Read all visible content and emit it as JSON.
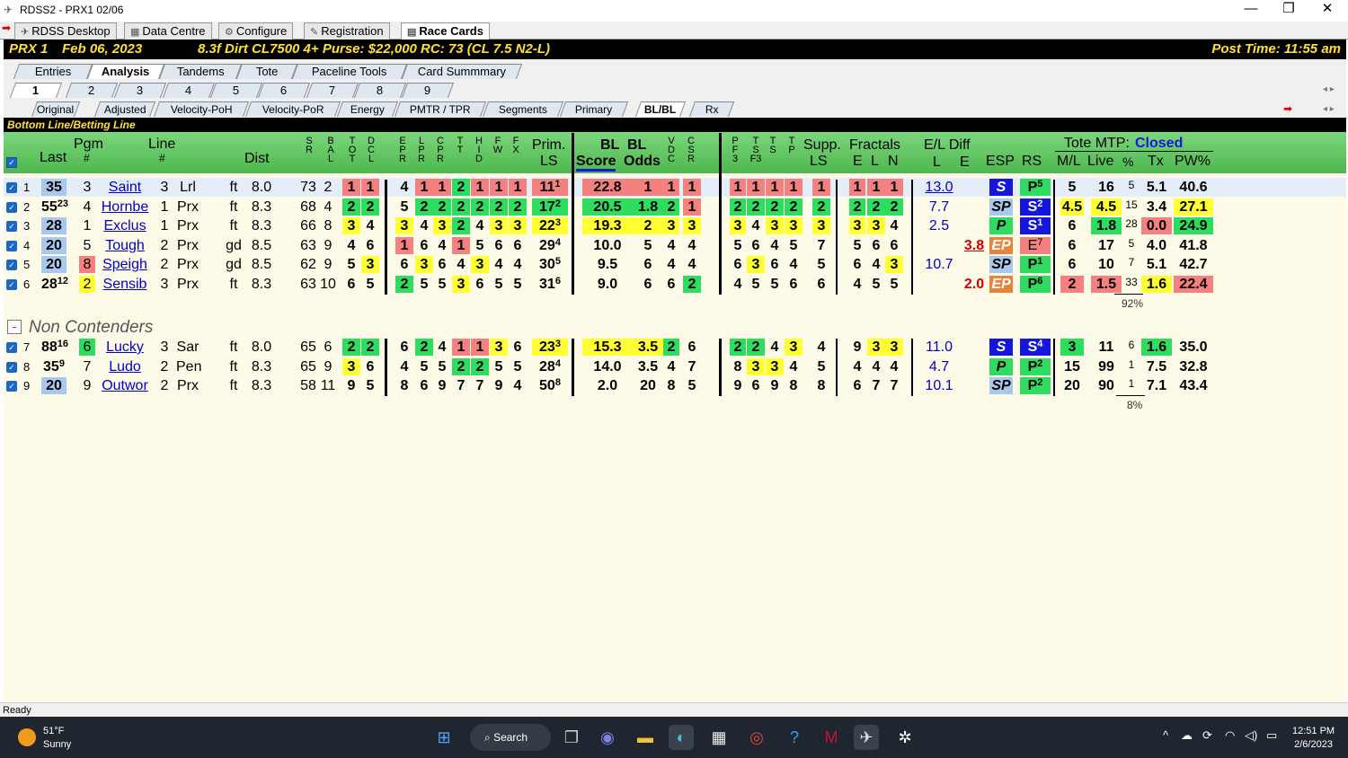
{
  "window": {
    "title": "RDSS2 - PRX1 02/06",
    "min": "—",
    "max": "❐",
    "close": "✕"
  },
  "topTabs": [
    {
      "label": "RDSS Desktop",
      "icon": "✈"
    },
    {
      "label": "Data Centre",
      "icon": "▦"
    },
    {
      "label": "Configure",
      "icon": "⚙"
    },
    {
      "label": "Registration",
      "icon": "✎"
    },
    {
      "label": "Race Cards",
      "icon": "▤"
    }
  ],
  "race": {
    "track": "PRX  1",
    "date": "Feb 06, 2023",
    "info": "8.3f  Dirt   CL7500  4+   Purse: $22,000   RC: 73  (CL 7.5 N2-L)",
    "post": "Post Time: 11:55 am"
  },
  "mainTabs": [
    "Entries",
    "Analysis",
    "Tandems",
    "Tote",
    "Paceline Tools",
    "Card Summmary"
  ],
  "raceTabs": [
    "1",
    "2",
    "3",
    "4",
    "5",
    "6",
    "7",
    "8",
    "9"
  ],
  "viewTabs": [
    "Original",
    "Adjusted",
    "Velocity-PoH",
    "Velocity-PoR",
    "Energy",
    "PMTR / TPR",
    "Segments",
    "Primary",
    "BL/BL",
    "Rx"
  ],
  "section": "Bottom Line/Betting Line",
  "headers": {
    "last": "Last",
    "pgm": "Pgm",
    "pgmHash": "#",
    "line": "Line",
    "lineHash": "#",
    "dist": "Dist",
    "sr": "S\nR",
    "bal": "B\nA\nL",
    "tot": "T\nO\nT",
    "dcl": "D\nC\nL",
    "epr": "E\nP\nR",
    "lpr": "L\nP\nR",
    "cpr": "C\nP\nR",
    "tt": "T\nT",
    "hid": "H\nI\nD",
    "fw": "F\nW",
    "fx": "F\nX",
    "prim": "Prim.",
    "primLs": "LS",
    "bl1": "BL",
    "bl2": "BL",
    "score": "Score",
    "odds": "Odds",
    "vdc": "V\nD\nC",
    "csr": "C\nS\nR",
    "pf3": "P\nF\n3",
    "tsf3": "T\nS\nF3",
    "ts": "T\nS",
    "tp": "T\nP",
    "supp": "Supp.",
    "suppLs": "LS",
    "fractals": "Fractals",
    "fE": "E",
    "fL": "L",
    "fN": "N",
    "el": "E/L Diff",
    "elL": "L",
    "elE": "E",
    "esp": "ESP",
    "rs": "RS",
    "toteMtp": "Tote MTP:",
    "toteState": "Closed",
    "ml": "M/L",
    "live": "Live",
    "pctH": "%",
    "tx": "Tx",
    "pw": "PW%"
  },
  "contenders": [
    {
      "n": "1",
      "last": "35",
      "lastSup": "",
      "pgm": "3",
      "name": "Saint ",
      "line": "3",
      "trk": "Lrl",
      "cond": "ft",
      "dist": "8.0",
      "sr": "73",
      "bal": "2",
      "tot": "1",
      "dcl": "1",
      "epr": "4",
      "lpr": "1",
      "cpr": "1",
      "tt": "2",
      "hid": "1",
      "fw": "1",
      "fx": "1",
      "prim": "11",
      "primSup": "1",
      "score": "22.8",
      "odds": "1",
      "vdc": "1",
      "csr": "1",
      "pf3": "1",
      "tsf3": "1",
      "ts": "1",
      "tp": "1",
      "supp": "1",
      "fe": "1",
      "fl": "1",
      "fn": "1",
      "elL": "13.0",
      "elE": "",
      "esp": "S",
      "rs": "P",
      "rsSup": "5",
      "ml": "5",
      "live": "16",
      "pct": "5",
      "tx": "5.1",
      "pw": "40.6"
    },
    {
      "n": "2",
      "last": "55",
      "lastSup": "23",
      "pgm": "4",
      "name": "Hornbe",
      "line": "1",
      "trk": "Prx",
      "cond": "ft",
      "dist": "8.3",
      "sr": "68",
      "bal": "4",
      "tot": "2",
      "dcl": "2",
      "epr": "5",
      "lpr": "2",
      "cpr": "2",
      "tt": "2",
      "hid": "2",
      "fw": "2",
      "fx": "2",
      "prim": "17",
      "primSup": "2",
      "score": "20.5",
      "odds": "1.8",
      "vdc": "2",
      "csr": "1",
      "pf3": "2",
      "tsf3": "2",
      "ts": "2",
      "tp": "2",
      "supp": "2",
      "fe": "2",
      "fl": "2",
      "fn": "2",
      "elL": "7.7",
      "elE": "",
      "esp": "SP",
      "rs": "S",
      "rsSup": "2",
      "ml": "4.5",
      "live": "4.5",
      "pct": "15",
      "tx": "3.4",
      "pw": "27.1"
    },
    {
      "n": "3",
      "last": "28",
      "lastSup": "",
      "pgm": "1",
      "name": "Exclus",
      "line": "1",
      "trk": "Prx",
      "cond": "ft",
      "dist": "8.3",
      "sr": "66",
      "bal": "8",
      "tot": "3",
      "dcl": "4",
      "epr": "3",
      "lpr": "4",
      "cpr": "3",
      "tt": "2",
      "hid": "4",
      "fw": "3",
      "fx": "3",
      "prim": "22",
      "primSup": "3",
      "score": "19.3",
      "odds": "2",
      "vdc": "3",
      "csr": "3",
      "pf3": "3",
      "tsf3": "4",
      "ts": "3",
      "tp": "3",
      "supp": "3",
      "fe": "3",
      "fl": "3",
      "fn": "4",
      "elL": "2.5",
      "elE": "",
      "esp": "P",
      "rs": "S",
      "rsSup": "1",
      "ml": "6",
      "live": "1.8",
      "pct": "28",
      "tx": "0.0",
      "pw": "24.9"
    },
    {
      "n": "4",
      "last": "20",
      "lastSup": "",
      "pgm": "5",
      "name": "Tough ",
      "line": "2",
      "trk": "Prx",
      "cond": "gd",
      "dist": "8.5",
      "sr": "63",
      "bal": "9",
      "tot": "4",
      "dcl": "6",
      "epr": "1",
      "lpr": "6",
      "cpr": "4",
      "tt": "1",
      "hid": "5",
      "fw": "6",
      "fx": "6",
      "prim": "29",
      "primSup": "4",
      "score": "10.0",
      "odds": "5",
      "vdc": "4",
      "csr": "4",
      "pf3": "5",
      "tsf3": "6",
      "ts": "4",
      "tp": "5",
      "supp": "7",
      "fe": "5",
      "fl": "6",
      "fn": "6",
      "elL": "",
      "elE": "3.8",
      "esp": "EP",
      "rs": "E",
      "rsSup": "7",
      "ml": "6",
      "live": "17",
      "pct": "5",
      "tx": "4.0",
      "pw": "41.8"
    },
    {
      "n": "5",
      "last": "20",
      "lastSup": "",
      "pgm": "8",
      "name": "Speigh",
      "line": "2",
      "trk": "Prx",
      "cond": "gd",
      "dist": "8.5",
      "sr": "62",
      "bal": "9",
      "tot": "5",
      "dcl": "3",
      "epr": "6",
      "lpr": "3",
      "cpr": "6",
      "tt": "4",
      "hid": "3",
      "fw": "4",
      "fx": "4",
      "prim": "30",
      "primSup": "5",
      "score": "9.5",
      "odds": "6",
      "vdc": "4",
      "csr": "4",
      "pf3": "6",
      "tsf3": "3",
      "ts": "6",
      "tp": "4",
      "supp": "5",
      "fe": "6",
      "fl": "4",
      "fn": "3",
      "elL": "10.7",
      "elE": "",
      "esp": "SP",
      "rs": "P",
      "rsSup": "1",
      "ml": "6",
      "live": "10",
      "pct": "7",
      "tx": "5.1",
      "pw": "42.7"
    },
    {
      "n": "6",
      "last": "28",
      "lastSup": "12",
      "pgm": "2",
      "name": "Sensib",
      "line": "3",
      "trk": "Prx",
      "cond": "ft",
      "dist": "8.3",
      "sr": "63",
      "bal": "10",
      "tot": "6",
      "dcl": "5",
      "epr": "2",
      "lpr": "5",
      "cpr": "5",
      "tt": "3",
      "hid": "6",
      "fw": "5",
      "fx": "5",
      "prim": "31",
      "primSup": "6",
      "score": "9.0",
      "odds": "6",
      "vdc": "6",
      "csr": "2",
      "pf3": "4",
      "tsf3": "5",
      "ts": "5",
      "tp": "6",
      "supp": "6",
      "fe": "4",
      "fl": "5",
      "fn": "5",
      "elL": "",
      "elE": "2.0",
      "esp": "EP",
      "rs": "P",
      "rsSup": "6",
      "ml": "2",
      "live": "1.5",
      "pct": "33",
      "tx": "1.6",
      "pw": "22.4"
    }
  ],
  "contendersPct": "92%",
  "nonContendersLabel": "Non Contenders",
  "nonContendersMinus": "-",
  "nonContenders": [
    {
      "n": "7",
      "last": "88",
      "lastSup": "16",
      "pgm": "6",
      "name": "Lucky ",
      "line": "3",
      "trk": "Sar",
      "cond": "ft",
      "dist": "8.0",
      "sr": "65",
      "bal": "6",
      "tot": "2",
      "dcl": "2",
      "epr": "6",
      "lpr": "2",
      "cpr": "4",
      "tt": "1",
      "hid": "1",
      "fw": "3",
      "fx": "6",
      "prim": "23",
      "primSup": "3",
      "score": "15.3",
      "odds": "3.5",
      "vdc": "2",
      "csr": "6",
      "pf3": "2",
      "tsf3": "2",
      "ts": "4",
      "tp": "3",
      "supp": "4",
      "fe": "9",
      "fl": "3",
      "fn": "3",
      "elL": "11.0",
      "elE": "",
      "esp": "S",
      "rs": "S",
      "rsSup": "4",
      "ml": "3",
      "live": "11",
      "pct": "6",
      "tx": "1.6",
      "pw": "35.0"
    },
    {
      "n": "8",
      "last": "35",
      "lastSup": "9",
      "pgm": "7",
      "name": "Ludo ",
      "line": "2",
      "trk": "Pen",
      "cond": "ft",
      "dist": "8.3",
      "sr": "65",
      "bal": "9",
      "tot": "3",
      "dcl": "6",
      "epr": "4",
      "lpr": "5",
      "cpr": "5",
      "tt": "2",
      "hid": "2",
      "fw": "5",
      "fx": "5",
      "prim": "28",
      "primSup": "4",
      "score": "14.0",
      "odds": "3.5",
      "vdc": "4",
      "csr": "7",
      "pf3": "8",
      "tsf3": "3",
      "ts": "3",
      "tp": "4",
      "supp": "5",
      "fe": "4",
      "fl": "4",
      "fn": "4",
      "elL": "4.7",
      "elE": "",
      "esp": "P",
      "rs": "P",
      "rsSup": "2",
      "ml": "15",
      "live": "99",
      "pct": "1",
      "tx": "7.5",
      "pw": "32.8"
    },
    {
      "n": "9",
      "last": "20",
      "lastSup": "",
      "pgm": "9",
      "name": "Outwor",
      "line": "2",
      "trk": "Prx",
      "cond": "ft",
      "dist": "8.3",
      "sr": "58",
      "bal": "11",
      "tot": "9",
      "dcl": "5",
      "epr": "8",
      "lpr": "6",
      "cpr": "9",
      "tt": "7",
      "hid": "7",
      "fw": "9",
      "fx": "4",
      "prim": "50",
      "primSup": "8",
      "score": "2.0",
      "odds": "20",
      "vdc": "8",
      "csr": "5",
      "pf3": "9",
      "tsf3": "6",
      "ts": "9",
      "tp": "8",
      "supp": "8",
      "fe": "6",
      "fl": "7",
      "fn": "7",
      "elL": "10.1",
      "elE": "",
      "esp": "SP",
      "rs": "P",
      "rsSup": "2",
      "ml": "20",
      "live": "90",
      "pct": "1",
      "tx": "7.1",
      "pw": "43.4"
    }
  ],
  "nonContendersPct": "8%",
  "status": "Ready",
  "taskbar": {
    "temp": "51°F",
    "weather": "Sunny",
    "search": "Search",
    "time": "12:51 PM",
    "date": "2/6/2023"
  },
  "colors": {
    "green": "#2edc60",
    "yellow": "#ffff33",
    "red": "#f48080",
    "lightblue": "#a9c8ee",
    "orange": "#e8843a",
    "blue": "#1515e0",
    "headerGreen": "#5cc45c"
  }
}
